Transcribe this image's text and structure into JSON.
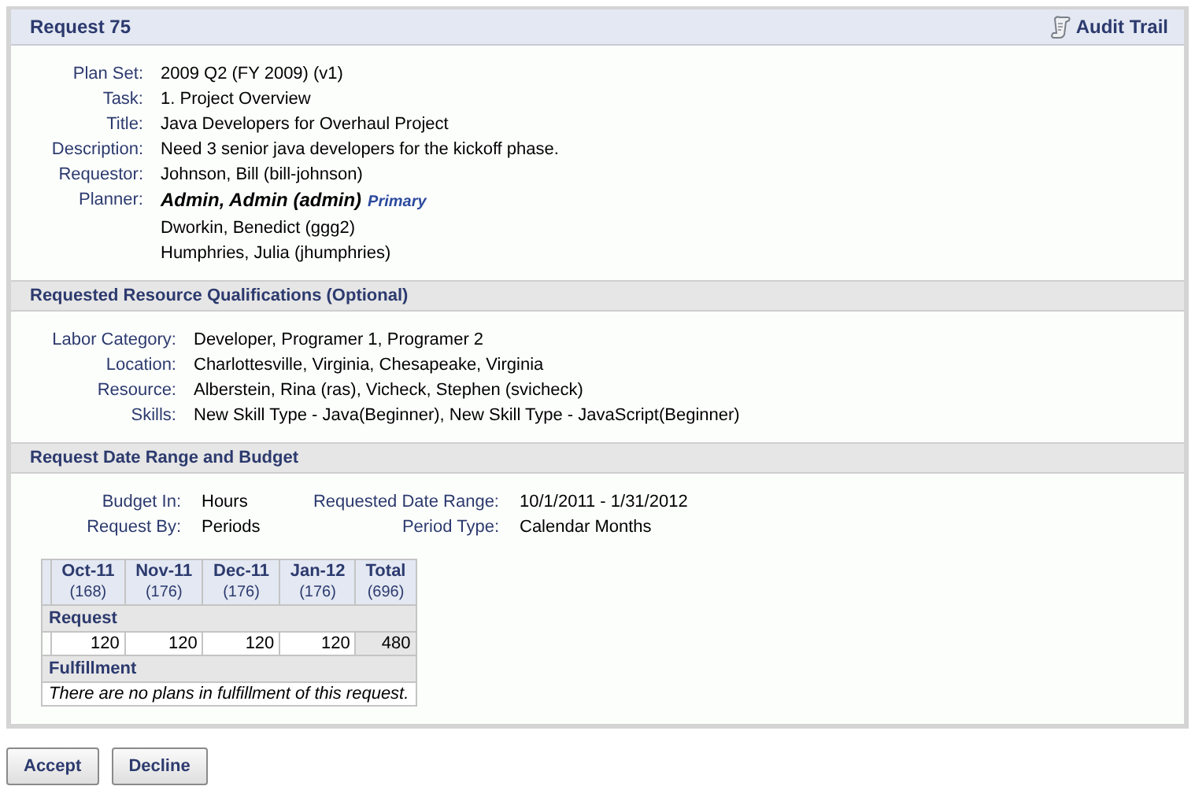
{
  "panel": {
    "title": "Request 75",
    "audit_trail": "Audit Trail"
  },
  "details": [
    {
      "label": "Plan Set:",
      "value": "2009 Q2 (FY 2009) (v1)"
    },
    {
      "label": "Task:",
      "value": "1. Project Overview"
    },
    {
      "label": "Title:",
      "value": "Java Developers for Overhaul Project"
    },
    {
      "label": "Description:",
      "value": "Need 3 senior java developers for the kickoff phase."
    },
    {
      "label": "Requestor:",
      "value": "Johnson, Bill (bill-johnson)"
    }
  ],
  "planners": {
    "label": "Planner:",
    "items": [
      {
        "name": "Admin, Admin (admin)",
        "primary": true,
        "badge": "Primary"
      },
      {
        "name": "Dworkin, Benedict (ggg2)",
        "primary": false
      },
      {
        "name": "Humphries, Julia (jhumphries)",
        "primary": false
      }
    ]
  },
  "qualifications": {
    "title": "Requested Resource Qualifications (Optional)",
    "rows": [
      {
        "label": "Labor Category:",
        "value": "Developer, Programer 1, Programer 2"
      },
      {
        "label": "Location:",
        "value": "Charlottesville, Virginia, Chesapeake, Virginia"
      },
      {
        "label": "Resource:",
        "value": "Alberstein, Rina (ras), Vicheck, Stephen (svicheck)"
      },
      {
        "label": "Skills:",
        "value": "New Skill Type - Java(Beginner), New Skill Type - JavaScript(Beginner)"
      }
    ]
  },
  "budget": {
    "title": "Request Date Range and Budget",
    "fields": [
      {
        "label": "Budget In:",
        "value": "Hours"
      },
      {
        "label": "Requested Date Range:",
        "value": "10/1/2011 - 1/31/2012"
      },
      {
        "label": "Request By:",
        "value": "Periods"
      },
      {
        "label": "Period Type:",
        "value": "Calendar Months"
      }
    ]
  },
  "table": {
    "columns": [
      {
        "label": "Oct-11",
        "sub": "(168)"
      },
      {
        "label": "Nov-11",
        "sub": "(176)"
      },
      {
        "label": "Dec-11",
        "sub": "(176)"
      },
      {
        "label": "Jan-12",
        "sub": "(176)"
      },
      {
        "label": "Total",
        "sub": "(696)"
      }
    ],
    "request_label": "Request",
    "request_values": [
      "120",
      "120",
      "120",
      "120",
      "480"
    ],
    "fulfillment_label": "Fulfillment",
    "fulfillment_message": "There are no plans in fulfillment of this request."
  },
  "buttons": [
    "Accept",
    "Decline"
  ]
}
